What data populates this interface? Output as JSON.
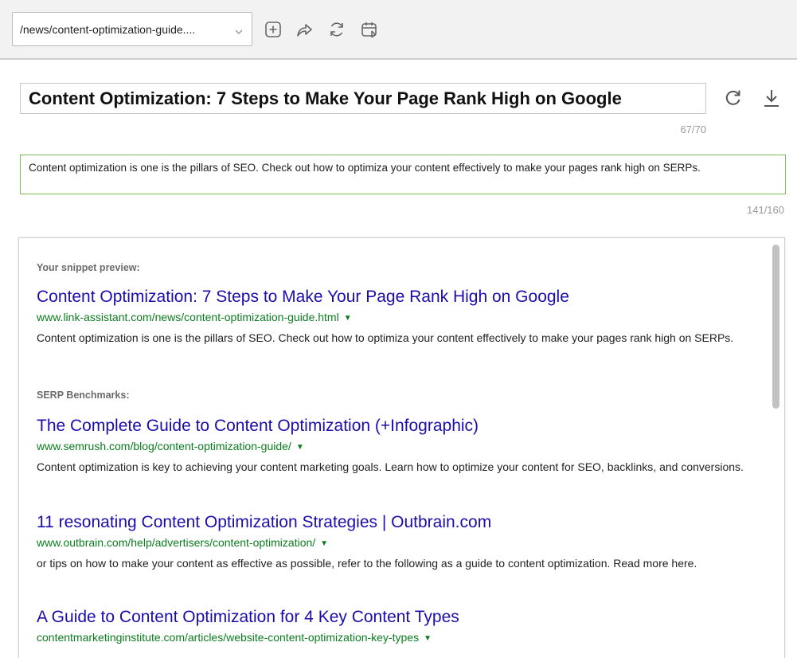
{
  "toolbar": {
    "url_value": "/news/content-optimization-guide....",
    "icons": [
      "add-icon",
      "share-icon",
      "refresh-icon",
      "schedule-icon"
    ]
  },
  "title": {
    "value": "Content Optimization: 7 Steps to Make Your Page Rank High on Google",
    "counter": "67/70"
  },
  "description": {
    "value": "Content optimization is one is the pillars of SEO. Check out how to optimiza your content effectively to make your pages rank high on SERPs.",
    "counter": "141/160"
  },
  "preview": {
    "snippet_label": "Your snippet preview:",
    "snippet": {
      "title": "Content Optimization: 7 Steps to Make Your Page Rank High on Google",
      "url": "www.link-assistant.com/news/content-optimization-guide.html",
      "description": "Content optimization is one is the pillars of SEO. Check out how to optimiza your content effectively to make your pages rank high on SERPs."
    },
    "benchmarks_label": "SERP Benchmarks:",
    "benchmarks": [
      {
        "title": "The Complete Guide to Content Optimization (+Infographic)",
        "url": "www.semrush.com/blog/content-optimization-guide/",
        "description": "Content optimization is key to achieving your content marketing goals. Learn how to optimize your content for SEO, backlinks, and conversions."
      },
      {
        "title": "11 resonating Content Optimization Strategies | Outbrain.com",
        "url": "www.outbrain.com/help/advertisers/content-optimization/",
        "description": "or tips on how to make your content as effective as possible, refer to the following as a guide to content optimization. Read more here."
      },
      {
        "title": "A Guide to Content Optimization for 4 Key Content Types",
        "url": "contentmarketinginstitute.com/articles/website-content-optimization-key-types",
        "description": ""
      }
    ]
  },
  "colors": {
    "link_title": "#1a0dab",
    "link_url": "#0b7c1e",
    "description_border": "#7fbd5a"
  }
}
